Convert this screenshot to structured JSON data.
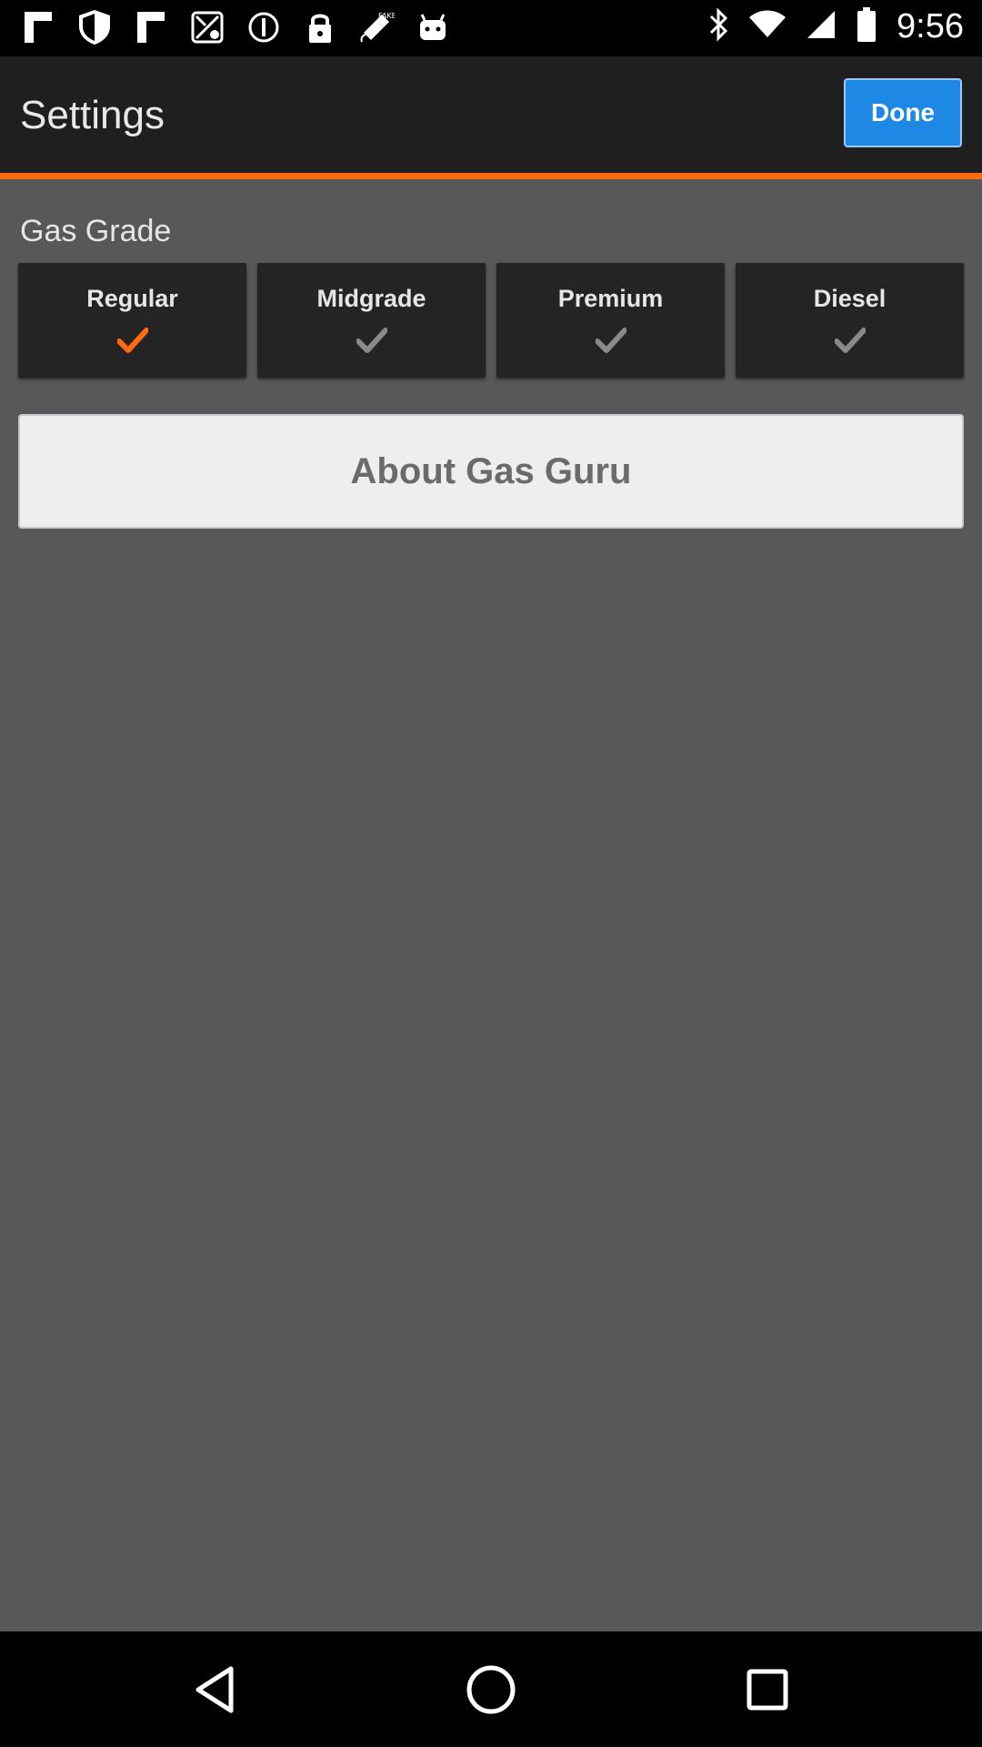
{
  "status_bar": {
    "time": "9:56",
    "left_icons": [
      "flipboard-icon",
      "shield-icon",
      "flipboard-icon",
      "maps-icon",
      "info-icon",
      "lock-icon",
      "fake-gps-icon",
      "android-icon"
    ],
    "right_icons": [
      "bluetooth-icon",
      "wifi-icon",
      "signal-icon",
      "battery-icon"
    ]
  },
  "header": {
    "title": "Settings",
    "done_label": "Done"
  },
  "gas_grade": {
    "label": "Gas Grade",
    "options": [
      {
        "label": "Regular",
        "selected": true
      },
      {
        "label": "Midgrade",
        "selected": false
      },
      {
        "label": "Premium",
        "selected": false
      },
      {
        "label": "Diesel",
        "selected": false
      }
    ]
  },
  "about_label": "About Gas Guru",
  "colors": {
    "accent": "#ff6a13",
    "done_button": "#1e88e5",
    "background": "#585858",
    "check_selected": "#ff6a13",
    "check_unselected": "#8a8a8a"
  },
  "nav_bar": {
    "buttons": [
      "back-icon",
      "home-icon",
      "recents-icon"
    ]
  }
}
